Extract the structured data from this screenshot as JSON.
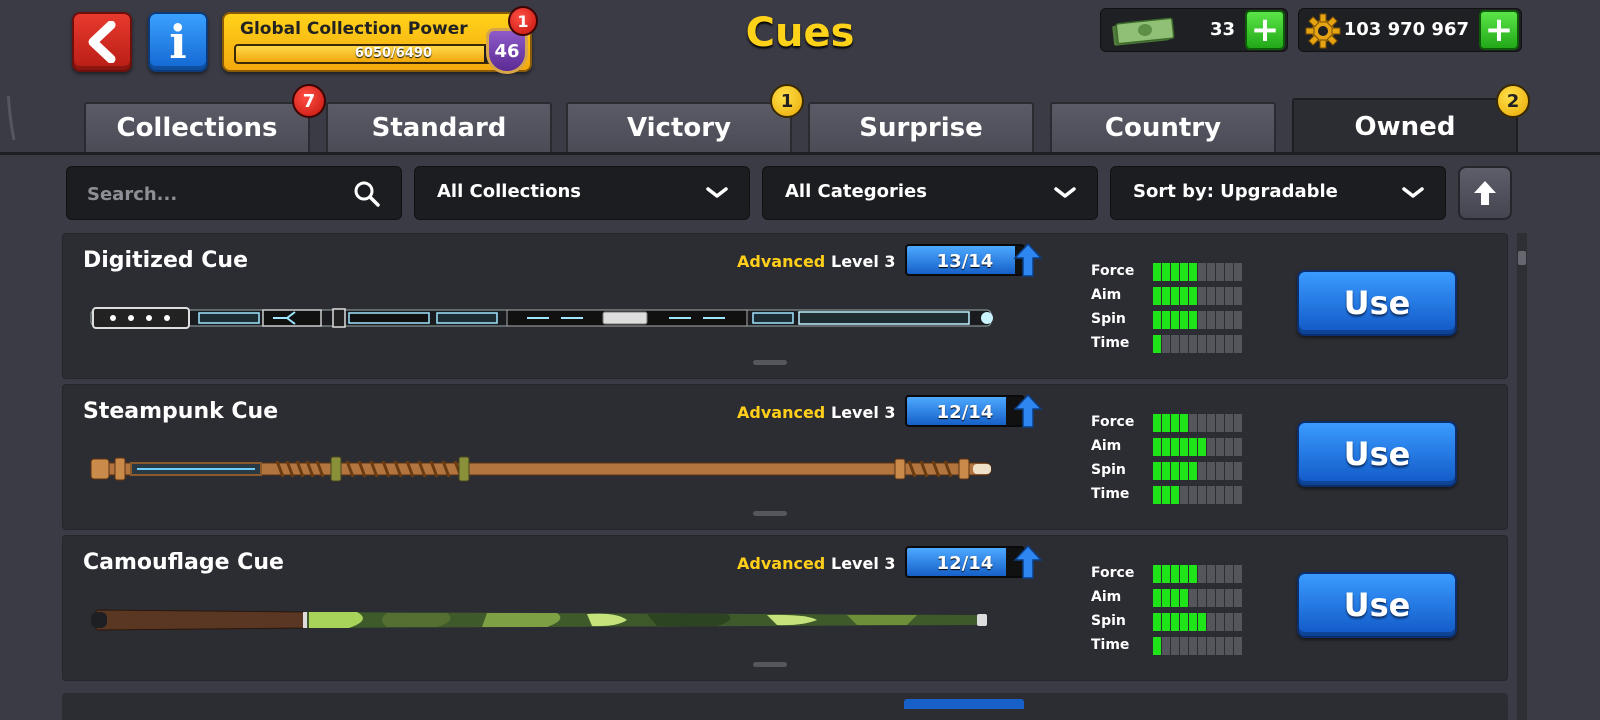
{
  "header": {
    "title": "Cues",
    "back_icon": "back-arrow-icon",
    "info_icon": "info-icon",
    "info_glyph": "i",
    "collection_power": {
      "label": "Global Collection Power",
      "value": "6050/6490",
      "progress": 0.932,
      "level": "46",
      "badge_count": "1"
    },
    "cash": {
      "amount": "33",
      "icon": "cash-icon",
      "plus": "+"
    },
    "coins": {
      "amount": "103 970 967",
      "icon": "gear-coin-icon",
      "plus": "+"
    }
  },
  "tabs": [
    {
      "label": "Collections",
      "badge": "7",
      "badge_color": "red"
    },
    {
      "label": "Standard"
    },
    {
      "label": "Victory",
      "badge": "1",
      "badge_color": "yellow"
    },
    {
      "label": "Surprise"
    },
    {
      "label": "Country"
    },
    {
      "label": "Owned",
      "badge": "2",
      "badge_color": "yellow",
      "active": true
    }
  ],
  "filters": {
    "search_placeholder": "Search...",
    "collections": "All Collections",
    "categories": "All Categories",
    "sort": "Sort by: Upgradable"
  },
  "cues": [
    {
      "name": "Digitized Cue",
      "tier": "Advanced",
      "level": "Level 3",
      "progress_text": "13/14",
      "progress": 0.929,
      "stats": {
        "Force": 5,
        "Aim": 5,
        "Spin": 5,
        "Time": 1
      },
      "use_label": "Use"
    },
    {
      "name": "Steampunk Cue",
      "tier": "Advanced",
      "level": "Level 3",
      "progress_text": "12/14",
      "progress": 0.857,
      "stats": {
        "Force": 4,
        "Aim": 6,
        "Spin": 5,
        "Time": 3
      },
      "use_label": "Use"
    },
    {
      "name": "Camouflage Cue",
      "tier": "Advanced",
      "level": "Level 3",
      "progress_text": "12/14",
      "progress": 0.857,
      "stats": {
        "Force": 5,
        "Aim": 4,
        "Spin": 6,
        "Time": 1
      },
      "use_label": "Use"
    }
  ],
  "stat_labels": [
    "Force",
    "Aim",
    "Spin",
    "Time"
  ],
  "stat_max": 10,
  "colors": {
    "accent_yellow": "#ffd21a",
    "stat_green": "#1fe41a",
    "use_blue": "#1f78e6",
    "tier_gold": "#ffcf1a"
  }
}
